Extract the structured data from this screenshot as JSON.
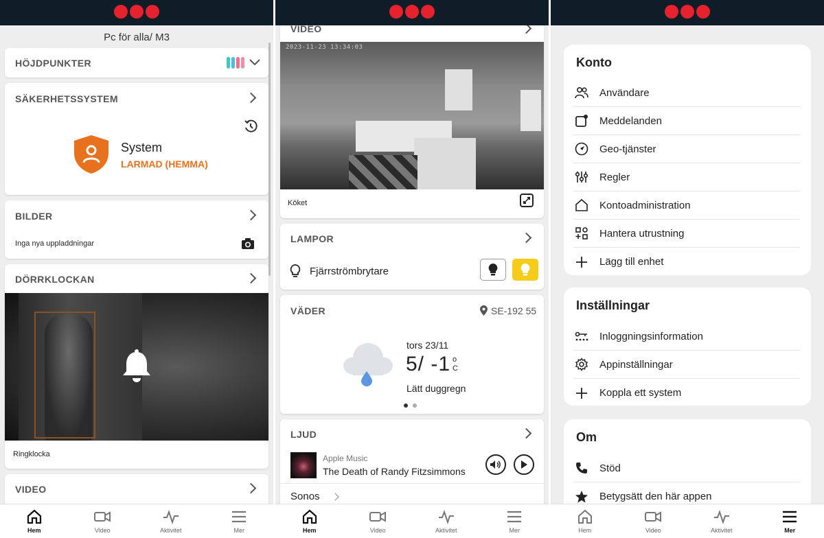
{
  "screen1": {
    "header": "Pc för alla/ M3",
    "highlights": {
      "title": "HÖJDPUNKTER",
      "stripe_colors": [
        "#3fc6c6",
        "#52b9e0",
        "#ef6e8a",
        "#f58ca0"
      ]
    },
    "security": {
      "title": "SÄKERHETSSYSTEM",
      "system_label": "System",
      "status": "LARMAD (HEMMA)",
      "status_color": "#e8711d"
    },
    "images": {
      "title": "BILDER",
      "text": "Inga nya uppladdningar"
    },
    "doorbell": {
      "title": "DÖRRKLOCKAN",
      "caption": "Ringklocka"
    },
    "video": {
      "title": "VIDEO"
    }
  },
  "screen2": {
    "video": {
      "title": "VIDEO",
      "timestamp": "2023-11-23 13:34:03",
      "caption": "Köket"
    },
    "lamps": {
      "title": "LAMPOR",
      "device": "Fjärrströmbrytare"
    },
    "weather": {
      "title": "VÄDER",
      "location": "SE-192 55",
      "day": "tors 23/11",
      "temp": "5/ -1",
      "unit_top": "o",
      "unit_bottom": "C",
      "desc": "Lätt duggregn"
    },
    "sound": {
      "title": "LJUD",
      "source": "Apple Music",
      "track": "The Death of Randy Fitzsimmons",
      "speaker": "Sonos"
    }
  },
  "screen3": {
    "account": {
      "title": "Konto",
      "items": [
        "Användare",
        "Meddelanden",
        "Geo-tjänster",
        "Regler",
        "Kontoadministration",
        "Hantera utrustning",
        "Lägg till enhet"
      ]
    },
    "settings": {
      "title": "Inställningar",
      "items": [
        "Inloggningsinformation",
        "Appinställningar",
        "Koppla ett system"
      ]
    },
    "about": {
      "title": "Om",
      "items": [
        "Stöd",
        "Betygsätt den här appen"
      ]
    }
  },
  "tabs": [
    "Hem",
    "Video",
    "Aktivitet",
    "Mer"
  ],
  "tab_icons": [
    "home-icon",
    "video-camera-icon",
    "activity-icon",
    "menu-icon"
  ]
}
